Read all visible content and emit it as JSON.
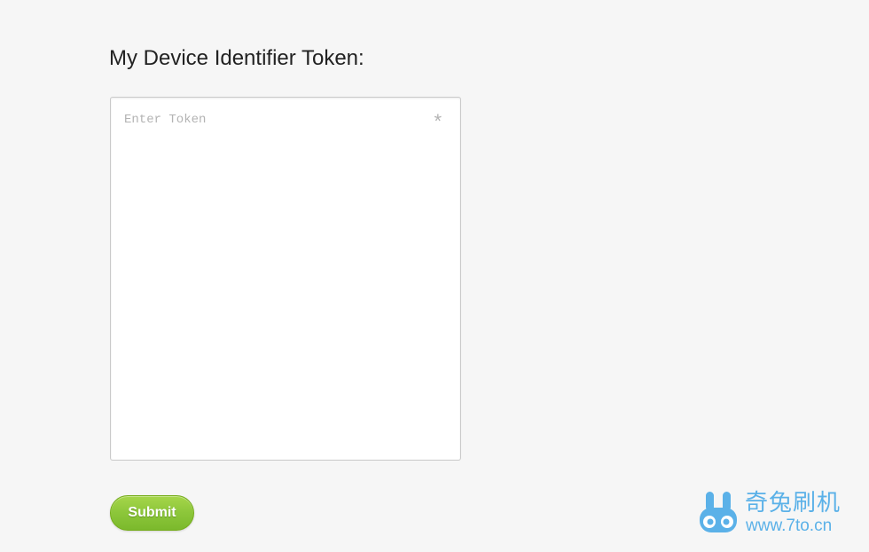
{
  "heading": "My Device Identifier Token:",
  "token_field": {
    "placeholder": "Enter Token",
    "value": "",
    "required_marker": "*"
  },
  "submit": {
    "label": "Submit"
  },
  "watermark": {
    "title": "奇兔刷机",
    "url": "www.7to.cn",
    "color": "#5bb1e8"
  },
  "colors": {
    "background": "#f6f6f6",
    "button_green": "#8cc63a",
    "placeholder_gray": "#b3b3b3"
  }
}
